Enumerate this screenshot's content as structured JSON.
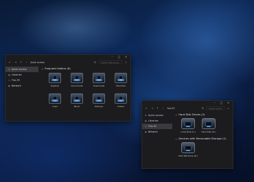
{
  "window1": {
    "breadcrumb": "Quick access",
    "search_placeholder": "Search Quick access",
    "sidebar": [
      {
        "label": "Quick access",
        "icon": "star-icon"
      },
      {
        "label": "Libraries",
        "icon": "library-icon"
      },
      {
        "label": "This PC",
        "icon": "computer-icon"
      },
      {
        "label": "Network",
        "icon": "network-icon"
      }
    ],
    "group_header": "Frequent folders (8)",
    "folders": [
      "Desktop",
      "Documents",
      "Downloads",
      "Favorites",
      "Links",
      "Music",
      "Pictures",
      "Videos"
    ]
  },
  "window2": {
    "breadcrumb": "This PC",
    "search_placeholder": "Search This PC",
    "sidebar": [
      {
        "label": "Quick access",
        "icon": "star-icon"
      },
      {
        "label": "Libraries",
        "icon": "library-icon"
      },
      {
        "label": "This PC",
        "icon": "computer-icon"
      },
      {
        "label": "Network",
        "icon": "network-icon"
      }
    ],
    "group_hdd": "Hard Disk Drives (2)",
    "drives": [
      "Local Disk (C:)",
      "Hard Disk (D:)"
    ],
    "group_removable": "Devices with Removable Storage (1)",
    "removable": [
      "DVD RW Drive (E:)"
    ]
  },
  "glyphs": {
    "back": "←",
    "forward": "→",
    "up": "↑",
    "refresh": "↻",
    "chevron": "›",
    "expand": "⌄",
    "minimize": "–",
    "maximize": "□",
    "close": "×",
    "search": "⌕"
  }
}
